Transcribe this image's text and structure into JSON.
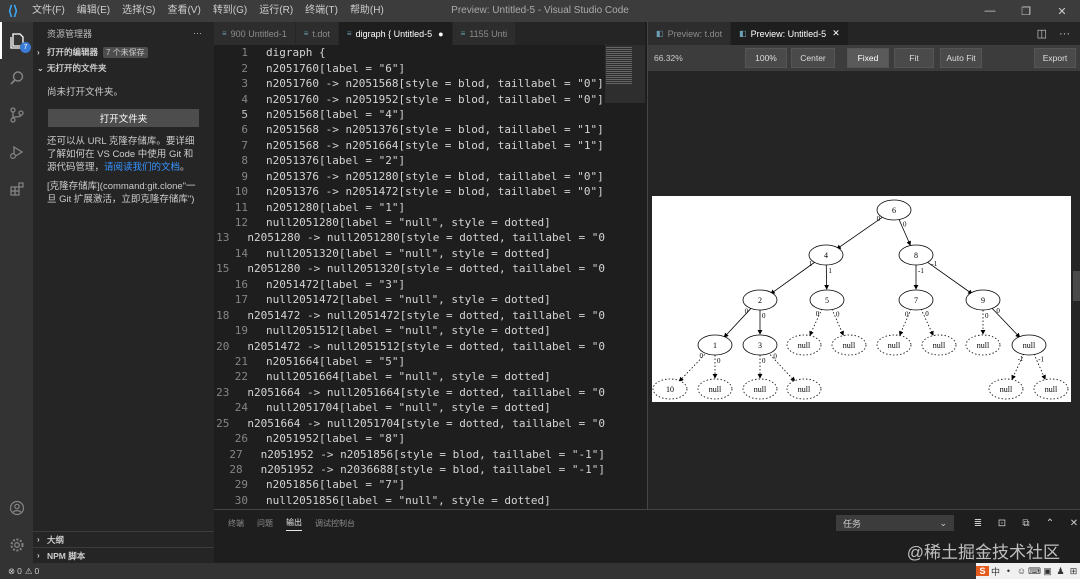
{
  "titlebar": {
    "menu": [
      "文件(F)",
      "编辑(E)",
      "选择(S)",
      "查看(V)",
      "转到(G)",
      "运行(R)",
      "终端(T)",
      "帮助(H)"
    ],
    "title": "Preview: Untitled-5 - Visual Studio Code"
  },
  "activity": {
    "badge": "7"
  },
  "sidebar": {
    "header": "资源管理器",
    "open_editors": "打开的编辑器",
    "dirty_badge": "7 个未保存",
    "no_folder_section": "无打开的文件夹",
    "no_folder_msg": "尚未打开文件夹。",
    "open_folder_button": "打开文件夹",
    "clone_msg_prefix": "还可以从 URL 克隆存储库。要详细了解如何在 VS Code 中使用 Git 和源代码管理，",
    "clone_link": "请阅读我们的文档",
    "clone_msg_suffix": "。",
    "clone_cmd_msg": "[克隆存储库](command:git.clone\"一旦 Git 扩展激活，立即克隆存储库\")",
    "outline": "大纲",
    "npm_scripts": "NPM 脚本"
  },
  "editor": {
    "tabs": [
      {
        "label": "900 Untitled-1",
        "active": false
      },
      {
        "label": "t.dot",
        "active": false
      },
      {
        "label": "digraph { Untitled-5",
        "active": true
      },
      {
        "label": "1155 Unti",
        "active": false
      }
    ],
    "lines": [
      "digraph {",
      "n2051760[label = \"6\"]",
      "n2051760 -> n2051568[style = blod, taillabel = \"0\"]",
      "n2051760 -> n2051952[style = blod, taillabel = \"0\"]",
      "n2051568[label = \"4\"]",
      "n2051568 -> n2051376[style = blod, taillabel = \"1\"]",
      "n2051568 -> n2051664[style = blod, taillabel = \"1\"]",
      "n2051376[label = \"2\"]",
      "n2051376 -> n2051280[style = blod, taillabel = \"0\"]",
      "n2051376 -> n2051472[style = blod, taillabel = \"0\"]",
      "n2051280[label = \"1\"]",
      "null2051280[label = \"null\", style = dotted]",
      "n2051280 -> null2051280[style = dotted, taillabel = \"0",
      "null2051320[label = \"null\", style = dotted]",
      "n2051280 -> null2051320[style = dotted, taillabel = \"0",
      "n2051472[label = \"3\"]",
      "null2051472[label = \"null\", style = dotted]",
      "n2051472 -> null2051472[style = dotted, taillabel = \"0",
      "null2051512[label = \"null\", style = dotted]",
      "n2051472 -> null2051512[style = dotted, taillabel = \"0",
      "n2051664[label = \"5\"]",
      "null2051664[label = \"null\", style = dotted]",
      "n2051664 -> null2051664[style = dotted, taillabel = \"0",
      "null2051704[label = \"null\", style = dotted]",
      "n2051664 -> null2051704[style = dotted, taillabel = \"0",
      "n2051952[label = \"8\"]",
      "n2051952 -> n2051856[style = blod, taillabel = \"-1\"]",
      "n2051952 -> n2036688[style = blod, taillabel = \"-1\"]",
      "n2051856[label = \"7\"]",
      "null2051856[label = \"null\", style = dotted]"
    ],
    "current_line": 5
  },
  "preview": {
    "tabs": [
      {
        "label": "Preview: t.dot",
        "active": false
      },
      {
        "label": "Preview: Untitled-5",
        "active": true
      }
    ],
    "zoom": "66.32%",
    "buttons": {
      "b100": "100%",
      "center": "Center",
      "fixed": "Fixed",
      "fit": "Fit",
      "autofit": "Auto Fit",
      "export": "Export"
    },
    "graph": {
      "node_labels": [
        "6",
        "4",
        "8",
        "2",
        "5",
        "7",
        "9",
        "1",
        "3",
        "null",
        "null",
        "null",
        "null",
        "null",
        "null",
        "10",
        "null",
        "null",
        "null",
        "null",
        "null",
        "null"
      ],
      "edge_labels": [
        "0",
        "0",
        "1",
        "1",
        "0",
        "0",
        "-1",
        "-1",
        "0",
        "0",
        "0",
        "0",
        "0",
        "0",
        "0",
        "0",
        "0",
        "0",
        "-1",
        "-1",
        "0",
        "0"
      ]
    }
  },
  "panel": {
    "tabs": [
      "终端",
      "问题",
      "输出",
      "调试控制台"
    ],
    "active_tab": "输出",
    "select_value": "任务"
  },
  "status": {
    "errors": "0",
    "warnings": "0"
  },
  "watermark": "@稀土掘金技术社区",
  "ime": [
    "中",
    "•",
    "☺",
    "⌨",
    "▣",
    "♟",
    "⊞"
  ]
}
